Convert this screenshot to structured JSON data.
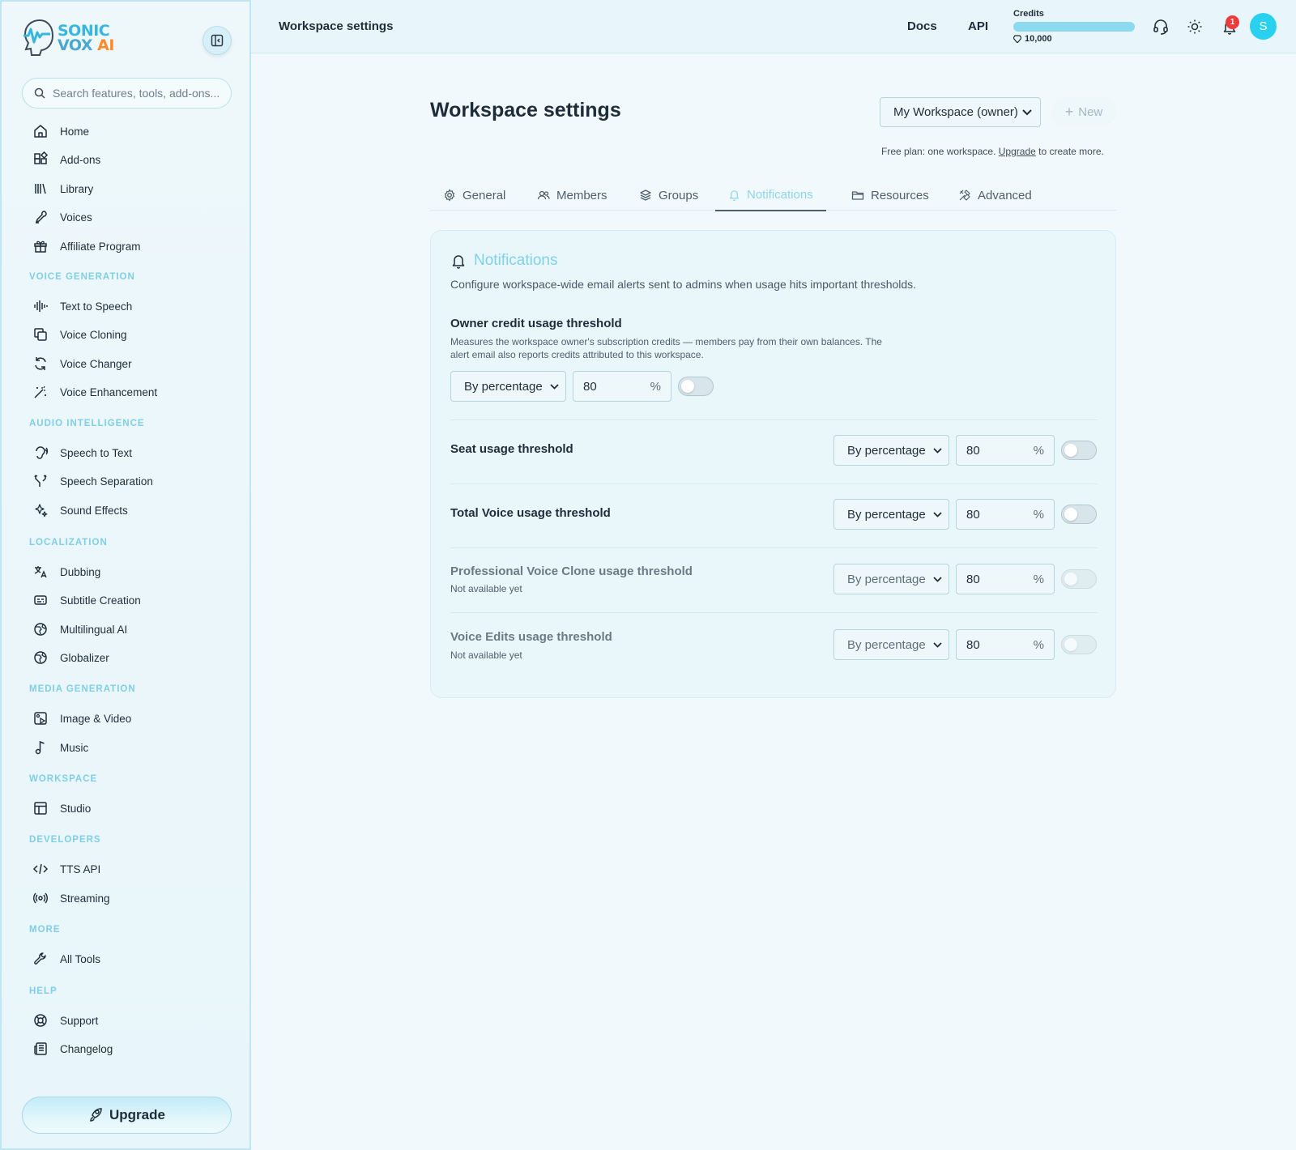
{
  "brand": {
    "line1": "SONIC",
    "line2": "VOX",
    "ai": "AI"
  },
  "sidebar": {
    "search_placeholder": "Search features, tools, add-ons...",
    "top_items": [
      {
        "label": "Home",
        "icon": "home-icon"
      },
      {
        "label": "Add-ons",
        "icon": "addons-icon"
      },
      {
        "label": "Library",
        "icon": "library-icon"
      },
      {
        "label": "Voices",
        "icon": "voices-icon"
      },
      {
        "label": "Affiliate Program",
        "icon": "gift-icon"
      }
    ],
    "sections": [
      {
        "title": "VOICE GENERATION",
        "items": [
          {
            "label": "Text to Speech",
            "icon": "audio-lines-icon"
          },
          {
            "label": "Voice Cloning",
            "icon": "copy-icon"
          },
          {
            "label": "Voice Changer",
            "icon": "refresh-icon"
          },
          {
            "label": "Voice Enhancement",
            "icon": "wand-icon"
          }
        ]
      },
      {
        "title": "AUDIO INTELLIGENCE",
        "items": [
          {
            "label": "Speech to Text",
            "icon": "ear-icon"
          },
          {
            "label": "Speech Separation",
            "icon": "split-icon"
          },
          {
            "label": "Sound Effects",
            "icon": "sparkles-icon"
          }
        ]
      },
      {
        "title": "LOCALIZATION",
        "items": [
          {
            "label": "Dubbing",
            "icon": "languages-icon"
          },
          {
            "label": "Subtitle Creation",
            "icon": "captions-icon"
          },
          {
            "label": "Multilingual AI",
            "icon": "globe-icon"
          },
          {
            "label": "Globalizer",
            "icon": "globe-icon"
          }
        ]
      },
      {
        "title": "MEDIA GENERATION",
        "items": [
          {
            "label": "Image & Video",
            "icon": "image-play-icon"
          },
          {
            "label": "Music",
            "icon": "music-icon"
          }
        ]
      },
      {
        "title": "WORKSPACE",
        "items": [
          {
            "label": "Studio",
            "icon": "layout-icon"
          }
        ]
      },
      {
        "title": "DEVELOPERS",
        "items": [
          {
            "label": "TTS API",
            "icon": "code-icon"
          },
          {
            "label": "Streaming",
            "icon": "radio-icon"
          }
        ]
      },
      {
        "title": "MORE",
        "items": [
          {
            "label": "All Tools",
            "icon": "wrench-icon"
          }
        ]
      },
      {
        "title": "HELP",
        "items": [
          {
            "label": "Support",
            "icon": "lifebuoy-icon"
          },
          {
            "label": "Changelog",
            "icon": "newspaper-icon"
          }
        ]
      }
    ],
    "upgrade_label": "Upgrade"
  },
  "topbar": {
    "title": "Workspace settings",
    "docs": "Docs",
    "api": "API",
    "credits_label": "Credits",
    "credits_value": "10,000",
    "credits_fill": 1.0,
    "notification_count": "1",
    "avatar_initial": "S"
  },
  "main": {
    "title": "Workspace settings",
    "workspace_select": "My Workspace (owner)",
    "new_label": "New",
    "plan_note_pre": "Free plan: one workspace.",
    "plan_note_link": "Upgrade",
    "plan_note_post": "to create more.",
    "tabs": [
      {
        "label": "General",
        "icon": "gear-icon"
      },
      {
        "label": "Members",
        "icon": "users-icon"
      },
      {
        "label": "Groups",
        "icon": "layers-icon"
      },
      {
        "label": "Notifications",
        "icon": "bell-icon",
        "active": true
      },
      {
        "label": "Resources",
        "icon": "folder-icon"
      },
      {
        "label": "Advanced",
        "icon": "tools-icon"
      }
    ]
  },
  "notifications": {
    "heading": "Notifications",
    "description": "Configure workspace-wide email alerts sent to admins when usage hits important thresholds.",
    "owner": {
      "title": "Owner credit usage threshold",
      "desc_line1": "Measures the workspace owner's subscription credits — members pay from their own balances. The",
      "desc_line2": "alert email also reports credits attributed to this workspace.",
      "mode": "By percentage",
      "value": "80",
      "unit": "%",
      "enabled": false
    },
    "rows": [
      {
        "title": "Seat usage threshold",
        "mode": "By percentage",
        "value": "80",
        "unit": "%",
        "enabled": false,
        "available": true
      },
      {
        "title": "Total Voice usage threshold",
        "mode": "By percentage",
        "value": "80",
        "unit": "%",
        "enabled": false,
        "available": true
      },
      {
        "title": "Professional Voice Clone usage threshold",
        "subtitle": "Not available yet",
        "mode": "By percentage",
        "value": "80",
        "unit": "%",
        "enabled": false,
        "available": false
      },
      {
        "title": "Voice Edits usage threshold",
        "subtitle": "Not available yet",
        "mode": "By percentage",
        "value": "80",
        "unit": "%",
        "enabled": false,
        "available": false
      }
    ]
  }
}
